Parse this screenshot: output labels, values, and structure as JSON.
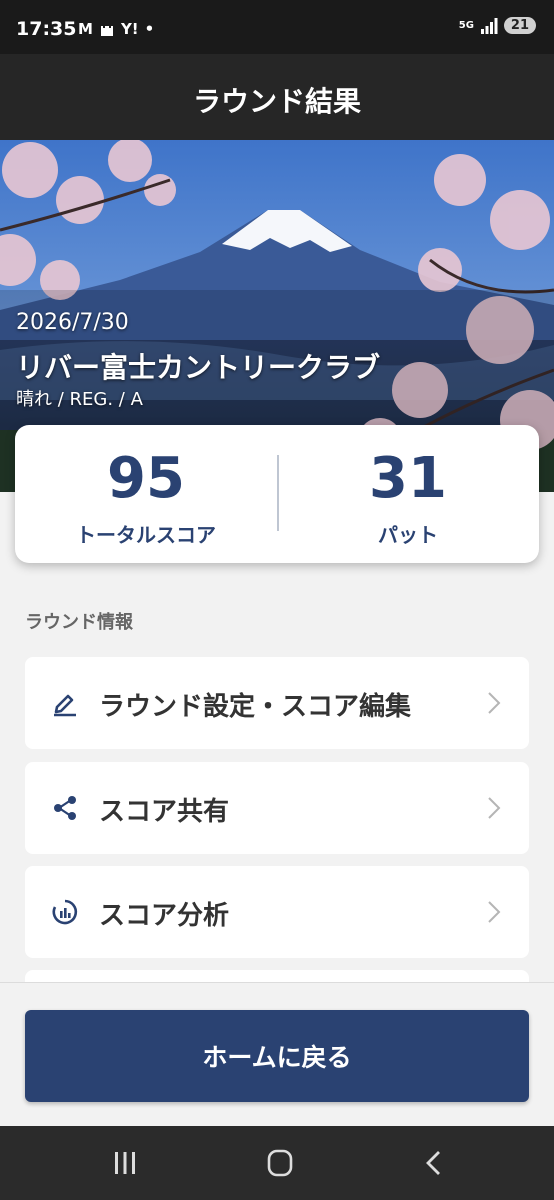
{
  "status_bar": {
    "time": "17:35",
    "notifications": [
      "M",
      "Y!"
    ],
    "network": "5G",
    "battery": "21"
  },
  "header": {
    "title": "ラウンド結果"
  },
  "round": {
    "date": "2026/7/30",
    "course": "リバー富士カントリークラブ",
    "conditions": "晴れ / REG. / A"
  },
  "scores": {
    "total_value": "95",
    "total_label": "トータルスコア",
    "putt_value": "31",
    "putt_label": "パット"
  },
  "section": {
    "title": "ラウンド情報"
  },
  "menu": [
    {
      "label": "ラウンド設定・スコア編集",
      "icon": "pencil-icon"
    },
    {
      "label": "スコア共有",
      "icon": "share-icon"
    },
    {
      "label": "スコア分析",
      "icon": "analysis-icon"
    }
  ],
  "footer": {
    "home_button": "ホームに戻る"
  },
  "colors": {
    "accent": "#2a4272",
    "header_bg": "#262626"
  }
}
